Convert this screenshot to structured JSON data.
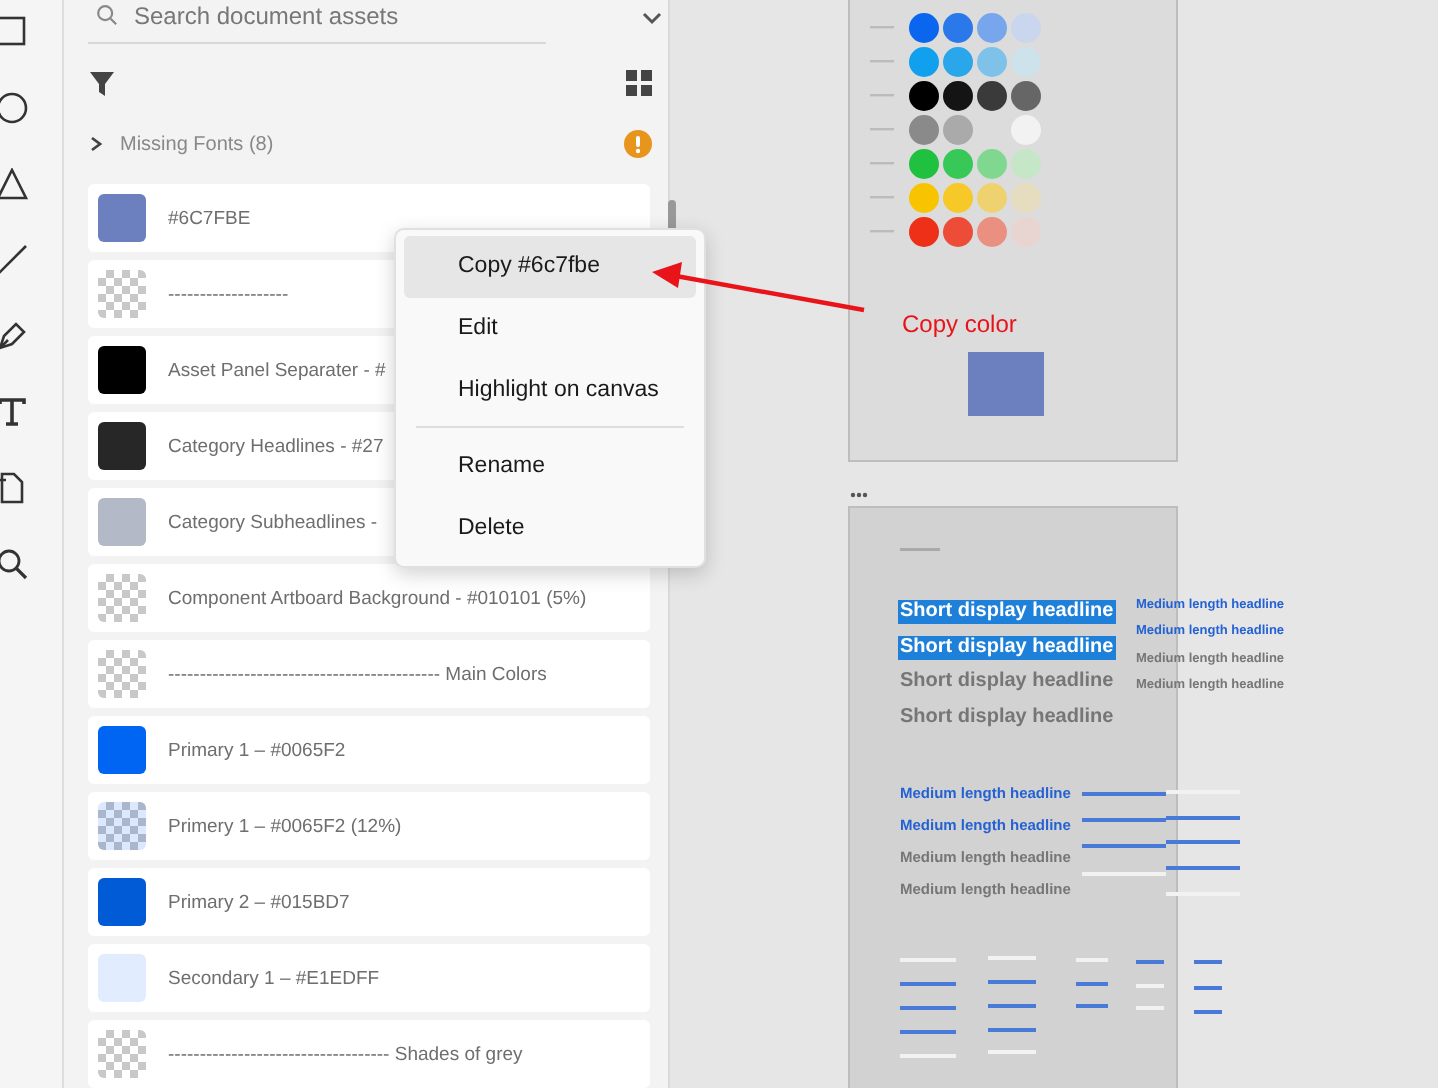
{
  "search": {
    "placeholder": "Search document assets"
  },
  "missing_fonts": {
    "label": "Missing Fonts (8)",
    "expanded": false
  },
  "assets": [
    {
      "label": "#6C7FBE",
      "kind": "solid",
      "color": "#6c7fbe"
    },
    {
      "label": "-------------------",
      "kind": "checker"
    },
    {
      "label": "Asset Panel Separater - #",
      "kind": "solid",
      "color": "#000000"
    },
    {
      "label": "Category Headlines - #27",
      "kind": "solid",
      "color": "#272727"
    },
    {
      "label": "Category Subheadlines -",
      "kind": "solid",
      "color": "#b3b9c6"
    },
    {
      "label": "Component Artboard Background - #010101 (5%)",
      "kind": "checker"
    },
    {
      "label": "------------------------------------------- Main Colors",
      "kind": "checker"
    },
    {
      "label": "Primary 1 – #0065F2",
      "kind": "solid",
      "color": "#0065f2"
    },
    {
      "label": "Primery 1 – #0065F2 (12%)",
      "kind": "tint"
    },
    {
      "label": "Primary 2 – #015BD7",
      "kind": "solid",
      "color": "#015bd7"
    },
    {
      "label": "Secondary 1 – #E1EDFF",
      "kind": "solid",
      "color": "#e1edff"
    },
    {
      "label": "----------------------------------- Shades of grey",
      "kind": "checker"
    }
  ],
  "context_menu": {
    "groups": [
      [
        {
          "label": "Copy #6c7fbe",
          "hovered": true
        },
        {
          "label": "Edit",
          "hovered": false
        },
        {
          "label": "Highlight on canvas",
          "hovered": false
        }
      ],
      [
        {
          "label": "Rename",
          "hovered": false
        },
        {
          "label": "Delete",
          "hovered": false
        }
      ]
    ]
  },
  "annotation": {
    "label": "Copy color"
  },
  "artboard_typography": {
    "display_headlines": [
      {
        "text": "Short display headline",
        "selected": true
      },
      {
        "text": "Short display headline",
        "selected": true
      },
      {
        "text": "Short display headline",
        "selected": false
      },
      {
        "text": "Short display headline",
        "selected": false
      }
    ],
    "side_headlines": [
      {
        "text": "Medium length headline",
        "kind": "blue"
      },
      {
        "text": "Medium length headline",
        "kind": "blue"
      },
      {
        "text": "Medium length headline",
        "kind": "white"
      },
      {
        "text": "Medium length headline",
        "kind": "white"
      }
    ],
    "medium_headlines": [
      {
        "text": "Medium length headline",
        "kind": "blue"
      },
      {
        "text": "Medium length headline",
        "kind": "blue"
      },
      {
        "text": "Medium length headline",
        "kind": "white"
      },
      {
        "text": "Medium length headline",
        "kind": "white"
      }
    ]
  }
}
